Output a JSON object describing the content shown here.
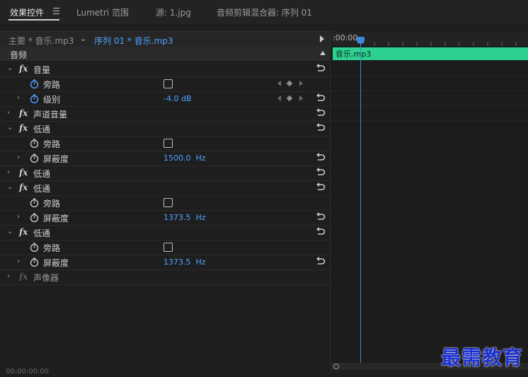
{
  "tabs": [
    {
      "label": "效果控件"
    },
    {
      "label": "Lumetri 范围"
    },
    {
      "label": "源: 1.jpg"
    },
    {
      "label": "音频剪辑混合器: 序列 01"
    }
  ],
  "sequence": {
    "master_label": "主要 * 音乐.mp3",
    "clip_label": "序列 01 * 音乐.mp3"
  },
  "section": {
    "label": "音频"
  },
  "rows": [
    {
      "label": "音量"
    },
    {
      "label": "旁路"
    },
    {
      "label": "级别",
      "value": "-4.0 dB"
    },
    {
      "label": "声道音量"
    },
    {
      "label": "低通"
    },
    {
      "label": "旁路"
    },
    {
      "label": "屏蔽度",
      "value": "1500.0",
      "unit": "Hz"
    },
    {
      "label": "低通"
    },
    {
      "label": "低通"
    },
    {
      "label": "旁路"
    },
    {
      "label": "屏蔽度",
      "value": "1373.5",
      "unit": "Hz"
    },
    {
      "label": "低通"
    },
    {
      "label": "旁路"
    },
    {
      "label": "屏蔽度",
      "value": "1373.5",
      "unit": "Hz"
    },
    {
      "label": "声像器"
    }
  ],
  "timeline": {
    "timecode": ":00:00",
    "clip_label": "音乐.mp3"
  },
  "footer": {
    "timecode": "00:00:00:00"
  },
  "watermark": "最需教育",
  "colors": {
    "accent": "#4fa3ff",
    "clip": "#2dd08e",
    "playhead": "#3a8ad8"
  }
}
